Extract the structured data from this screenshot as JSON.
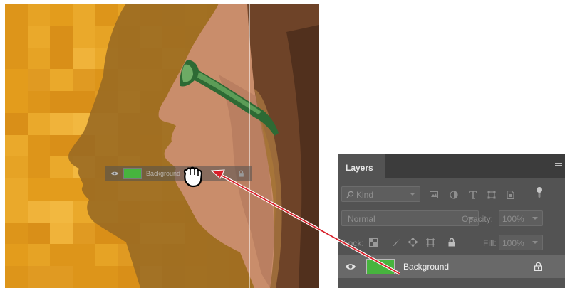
{
  "layers_panel": {
    "tab_label": "Layers",
    "filter": {
      "kind_label": "Kind",
      "icons": [
        "pixel-filter-icon",
        "adjustment-filter-icon",
        "type-filter-icon",
        "shape-filter-icon",
        "smart-object-filter-icon",
        "filter-toggle-icon"
      ]
    },
    "blend_mode": "Normal",
    "opacity_label": "Opacity:",
    "opacity_value": "100%",
    "lock_label": "Lock:",
    "lock_icons": [
      "lock-transparent-pixels-icon",
      "lock-image-pixels-icon",
      "lock-position-icon",
      "lock-artboard-icon",
      "lock-all-icon"
    ],
    "fill_label": "Fill:",
    "fill_value": "100%",
    "layers": [
      {
        "name": "Background",
        "visible": true,
        "locked": true,
        "thumbnail_color": "#47b43e"
      }
    ]
  },
  "drag_ghost": {
    "layer_name": "Background"
  },
  "colors": {
    "canvas_orange": "#e8a624",
    "panel_bg": "#535353",
    "tab_bar_bg": "#3c3c3c",
    "selected_row": "#696969",
    "arrow": "#d8202a",
    "layer_thumbnail": "#47b43e"
  }
}
